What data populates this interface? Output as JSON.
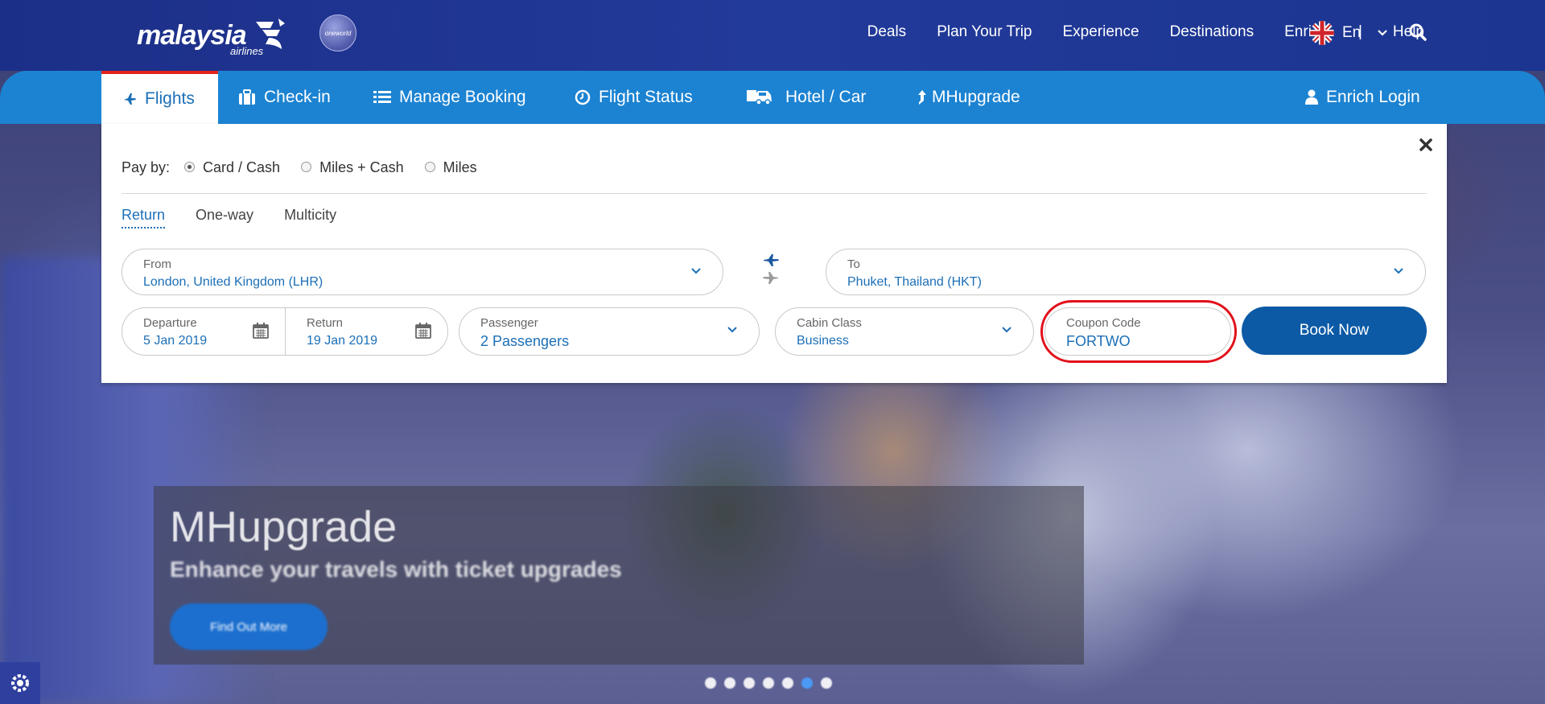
{
  "brand": {
    "name": "malaysia",
    "sub": "airlines",
    "alliance": "oneworld"
  },
  "topnav": {
    "items": [
      "Deals",
      "Plan Your Trip",
      "Experience",
      "Destinations",
      "Enrich"
    ],
    "separator": "|",
    "help": "Help",
    "language": "En"
  },
  "tabs": [
    {
      "label": "Flights",
      "icon": "plane-icon",
      "active": true
    },
    {
      "label": "Check-in",
      "icon": "suitcase-icon"
    },
    {
      "label": "Manage Booking",
      "icon": "list-icon"
    },
    {
      "label": "Flight Status",
      "icon": "clock-icon"
    },
    {
      "label": "Hotel / Car",
      "icon": "car-icon"
    },
    {
      "label": "MHupgrade",
      "icon": "upgrade-arrow-icon"
    }
  ],
  "login": "Enrich Login",
  "booking": {
    "pay_by_label": "Pay by:",
    "pay_options": [
      "Card / Cash",
      "Miles + Cash",
      "Miles"
    ],
    "pay_selected": "Card / Cash",
    "trip_types": [
      "Return",
      "One-way",
      "Multicity"
    ],
    "trip_selected": "Return",
    "from": {
      "label": "From",
      "value": "London, United Kingdom (LHR)"
    },
    "to": {
      "label": "To",
      "value": "Phuket, Thailand (HKT)"
    },
    "departure": {
      "label": "Departure",
      "value": "5 Jan 2019"
    },
    "return": {
      "label": "Return",
      "value": "19 Jan 2019"
    },
    "passenger": {
      "label": "Passenger",
      "value": "2 Passengers"
    },
    "cabin": {
      "label": "Cabin Class",
      "value": "Business"
    },
    "coupon": {
      "label": "Coupon Code",
      "value": "FORTWO"
    },
    "book_button": "Book Now"
  },
  "promo": {
    "title": "MHupgrade",
    "subtitle": "Enhance your travels with ticket upgrades",
    "button": "Find Out More",
    "slide_count": 7,
    "active_slide": 6
  },
  "colors": {
    "header": "#1c2f88",
    "tabbar": "#1c83d2",
    "accent_red": "#e2231a",
    "primary_blue": "#0c5aa6",
    "link_blue": "#1c6fb7"
  }
}
